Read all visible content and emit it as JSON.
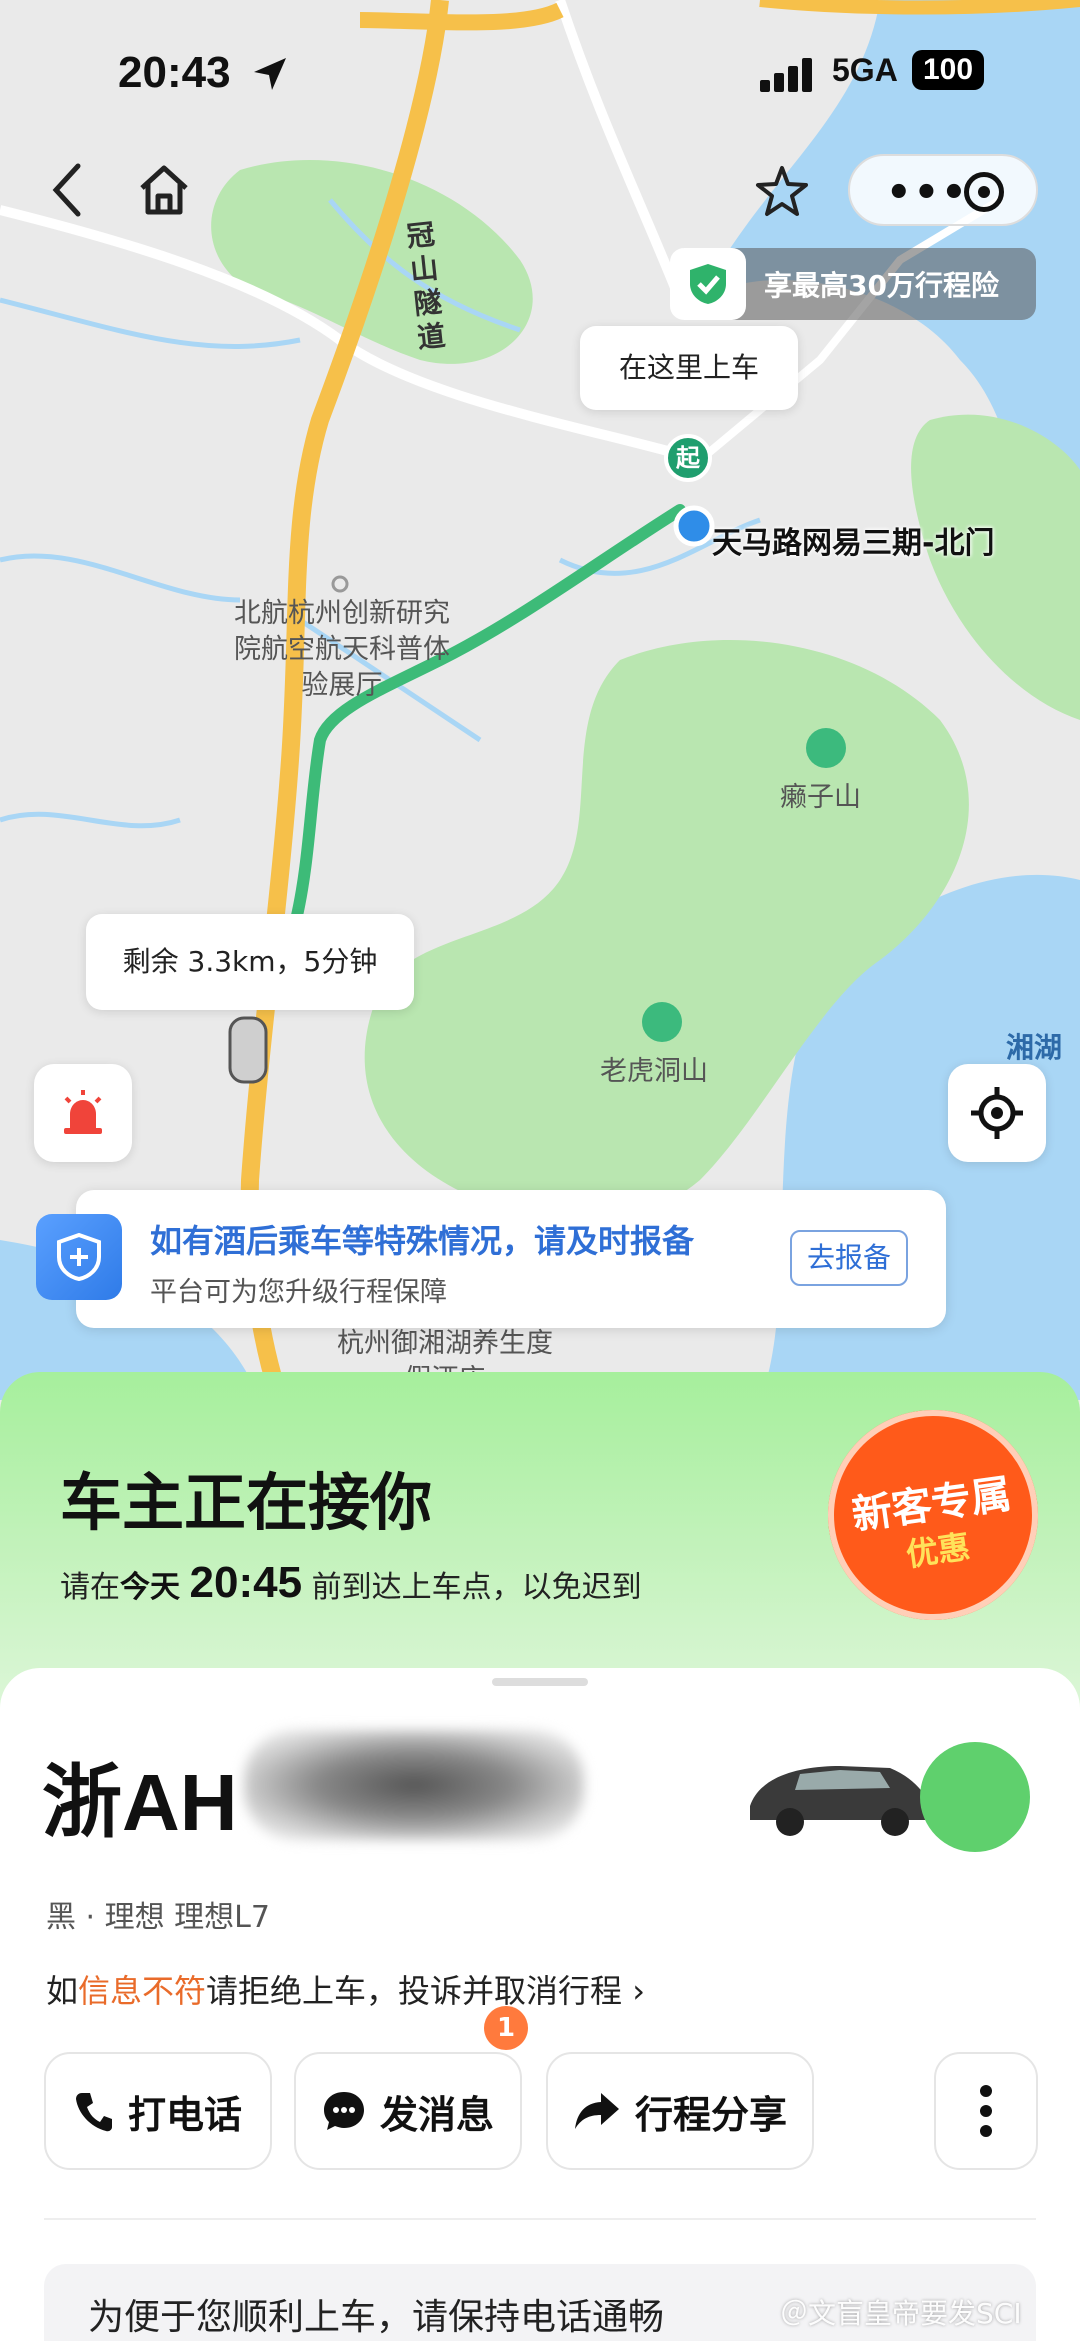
{
  "status_bar": {
    "time": "20:43",
    "network": "5GA",
    "battery": "100"
  },
  "map": {
    "pickup_bubble": "在这里上车",
    "start_marker": "起",
    "destination_label": "天马路网易三期-北门",
    "remaining_bubble": "剩余 3.3km，5分钟",
    "insurance_banner": "享最高30万行程险",
    "road_labels": [
      "冠山隧道",
      "湘湖"
    ],
    "poi_labels": [
      "北航杭州创新研究院航空航天科普体验展厅",
      "癞子山",
      "老虎洞山",
      "杭州御湘湖养生度假酒店"
    ],
    "colors": {
      "route": "#3dbb78",
      "water": "#a9d6f5",
      "green": "#b9e6b0",
      "road": "#f6c04a"
    }
  },
  "notice": {
    "title": "如有酒后乘车等特殊情况，请及时报备",
    "subtitle": "平台可为您升级行程保障",
    "button": "去报备"
  },
  "trip": {
    "status_title": "车主正在接你",
    "arrive_prefix": "请在",
    "arrive_today": "今天",
    "arrive_time": "20:45",
    "arrive_suffix": "前到达上车点，以免迟到",
    "promo_line1": "新客专属",
    "promo_line2": "优惠"
  },
  "driver": {
    "plate_visible": "浙AH",
    "car_info": "黑 · 理想 理想L7",
    "warn_prefix": "如",
    "warn_highlight": "信息不符",
    "warn_suffix": "请拒绝上车，投诉并取消行程 ›"
  },
  "actions": {
    "call": "打电话",
    "message": "发消息",
    "message_badge": "1",
    "share": "行程分享"
  },
  "tip": "为便于您顺利上车，请保持电话通畅",
  "watermark": "＠文盲皇帝要发SCI"
}
